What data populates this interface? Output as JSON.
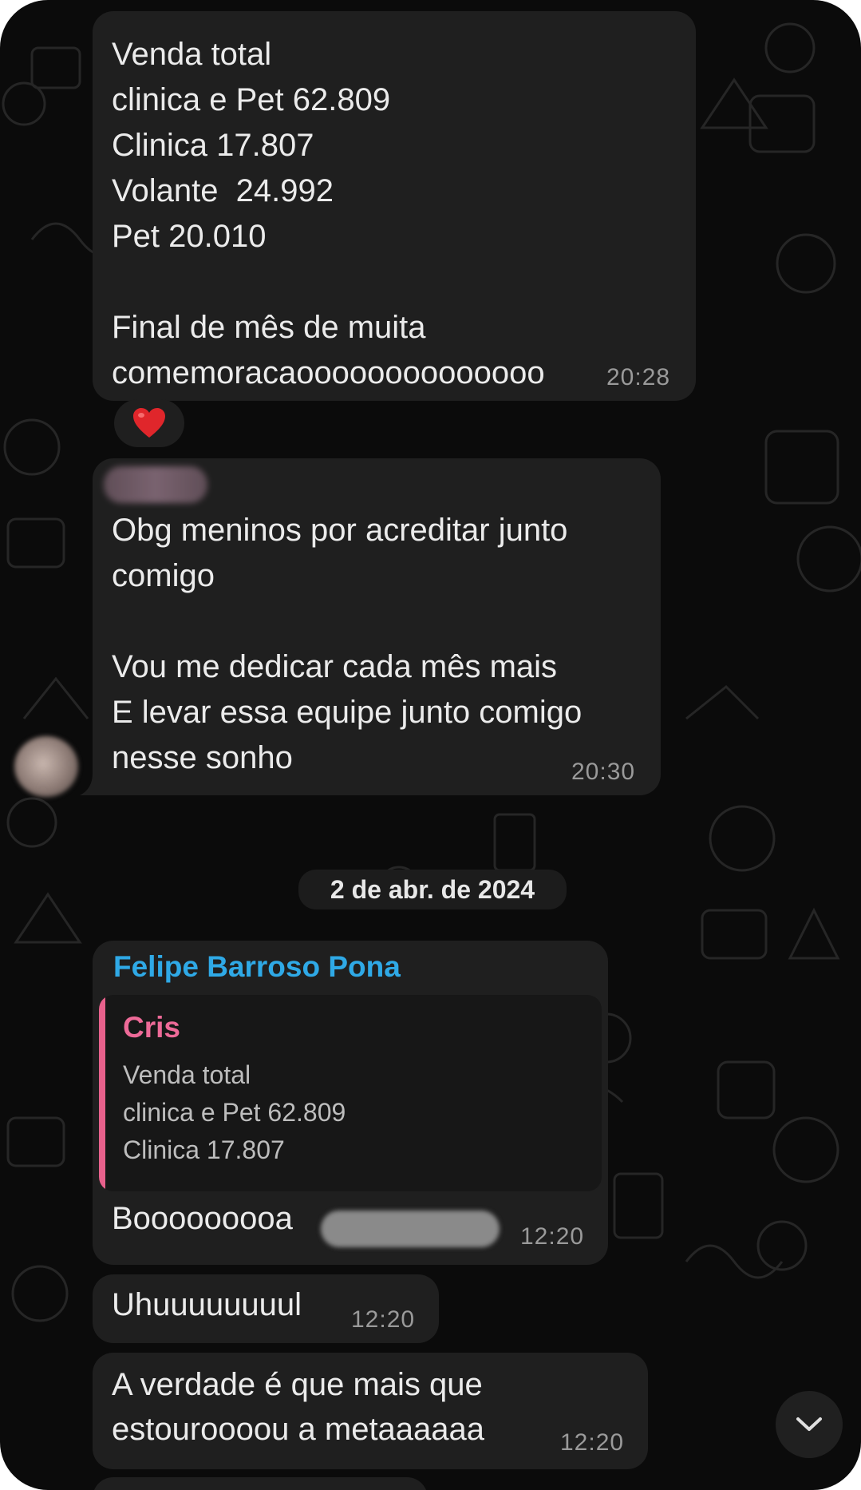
{
  "chat": {
    "messages": [
      {
        "lines": [
          "Venda total",
          "clinica e Pet 62.809",
          "Clinica 17.807",
          "Volante  24.992",
          "Pet 20.010",
          "",
          "Final de mês de muita",
          "comemoracaoooooooooooooo"
        ],
        "time": "20:28",
        "reaction": "heart"
      },
      {
        "lines": [
          "Obg meninos por acreditar junto",
          "comigo",
          "",
          "Vou me dedicar cada mês mais",
          "E levar essa equipe junto comigo",
          "nesse sonho"
        ],
        "time": "20:30"
      }
    ],
    "date_separator": "2 de abr. de 2024",
    "reply_message": {
      "sender": "Felipe Barroso Pona",
      "quoted_author": "Cris",
      "quoted_lines": [
        "Venda total",
        "clinica e Pet 62.809",
        "Clinica 17.807"
      ],
      "text": "Booooooooa",
      "time": "12:20"
    },
    "short_message": {
      "text": "Uhuuuuuuuul",
      "time": "12:20"
    },
    "last_message": {
      "lines": [
        "A verdade é que mais que",
        "estouroooou a metaaaaaa"
      ],
      "time": "12:20"
    }
  },
  "colors": {
    "background": "#0b0b0b",
    "bubble": "#1f1f1f",
    "sender_name": "#2fa9e6",
    "quote_accent": "#e8618c",
    "timestamp": "#9a9a9a"
  },
  "icons": {
    "reaction": "red-heart-icon",
    "scroll": "chevron-down-icon"
  }
}
